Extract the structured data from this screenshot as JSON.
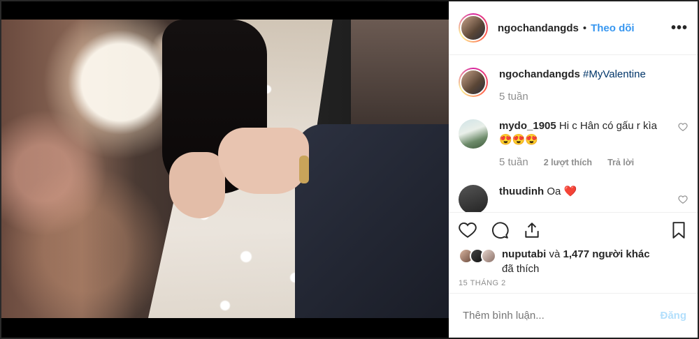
{
  "header": {
    "username": "ngochandangds",
    "separator": "•",
    "follow_label": "Theo dõi",
    "more_icon": "•••"
  },
  "caption": {
    "username": "ngochandangds",
    "hashtag": "#MyValentine",
    "time": "5 tuần"
  },
  "comments": [
    {
      "username": "mydo_1905",
      "text": "Hi c Hân có gấu r kìa",
      "emojis": "😍😍😍",
      "time": "5 tuần",
      "likes": "2 lượt thích",
      "reply_label": "Trả lời"
    },
    {
      "username": "thuudinh",
      "text": "Oa",
      "emojis": "❤️"
    }
  ],
  "likes": {
    "first_user": "nuputabi",
    "connector": "và",
    "others": "1,477 người khác",
    "suffix": "đã thích"
  },
  "date": "15 THÁNG 2",
  "add_comment": {
    "placeholder": "Thêm bình luận...",
    "post_label": "Đăng"
  }
}
